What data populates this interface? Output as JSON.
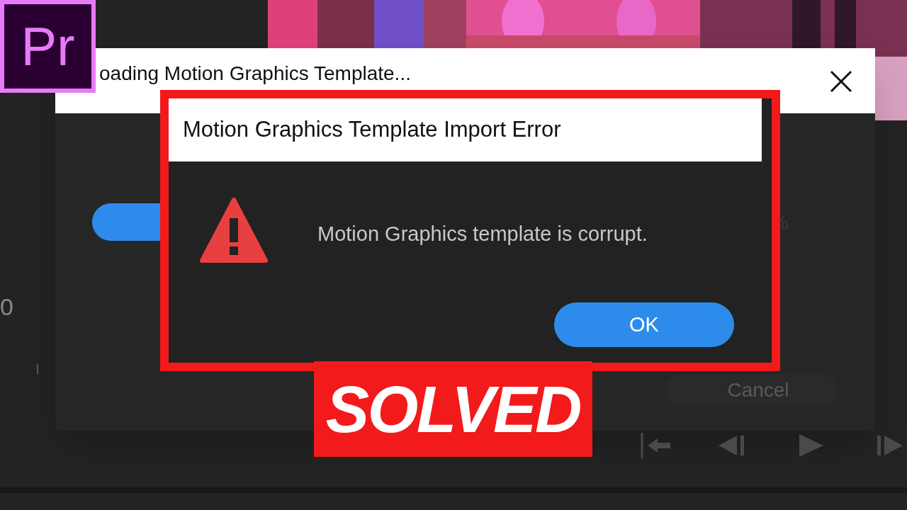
{
  "app_badge": {
    "text": "Pr"
  },
  "loading_dialog": {
    "title": "oading Motion Graphics Template...",
    "percent": "%",
    "cancel_button": "Cancel"
  },
  "side_readout": "0",
  "error_dialog": {
    "title": "Motion Graphics Template Import Error",
    "message": "Motion Graphics template is corrupt.",
    "ok_button": "OK",
    "highlighted": true
  },
  "banner": {
    "text": "SOLVED"
  }
}
